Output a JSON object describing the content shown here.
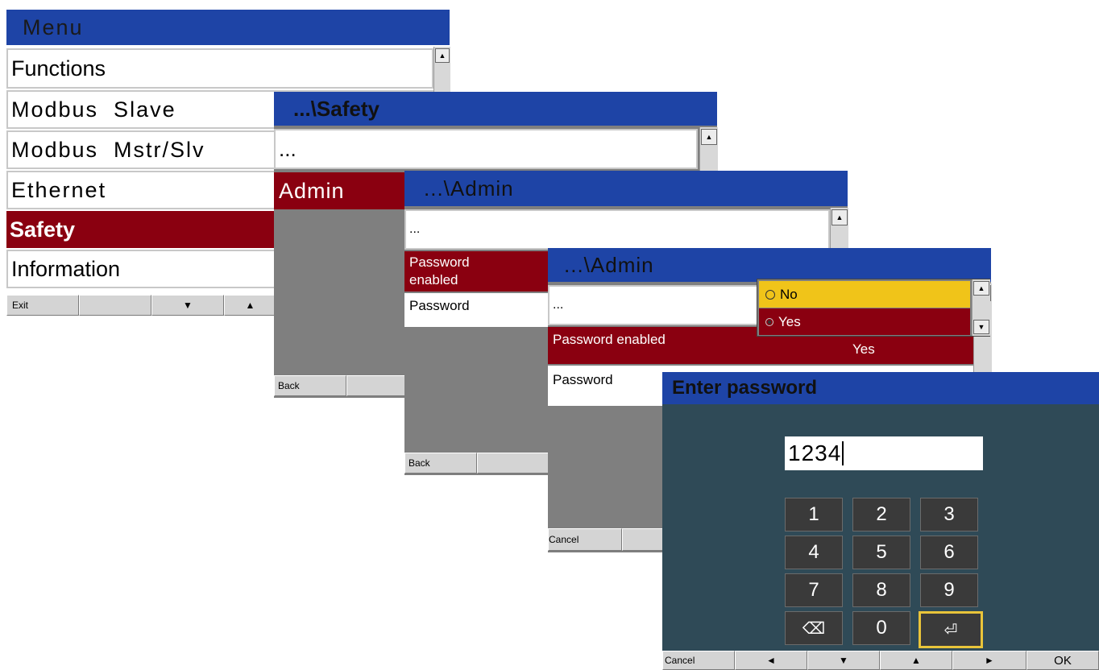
{
  "menu": {
    "title": "Menu",
    "items": [
      "Functions",
      "Modbus  Slave",
      "Modbus  Mstr/Slv",
      "Ethernet",
      "Safety",
      "Information"
    ],
    "softkeys": [
      "Exit",
      "",
      "▼",
      "▲"
    ]
  },
  "safety": {
    "title": "...\\Safety",
    "up": "...",
    "items": [
      "Admin"
    ],
    "softkeys": [
      "Back",
      ""
    ]
  },
  "admin": {
    "title": "...\\Admin",
    "up": "...",
    "items": [
      "Password enabled",
      "Password"
    ],
    "softkeys": [
      "Back",
      ""
    ]
  },
  "admin2": {
    "title": "...\\Admin",
    "up": "...",
    "row_label": "Password enabled",
    "row_value": "Yes",
    "row2_label": "Password",
    "softkeys": [
      "Cancel",
      ""
    ],
    "dropdown": {
      "options": [
        {
          "label": "No",
          "selected": false
        },
        {
          "label": "Yes",
          "selected": true
        }
      ]
    }
  },
  "password": {
    "title": "Enter password",
    "value": "1234",
    "keys": [
      "1",
      "2",
      "3",
      "4",
      "5",
      "6",
      "7",
      "8",
      "9",
      "⌫",
      "0",
      "⏎"
    ],
    "softkeys": [
      "Cancel",
      "◄",
      "▼",
      "▲",
      "►",
      "OK"
    ]
  },
  "colors": {
    "title_blue": "#1e44a6",
    "selection_red": "#8a0010",
    "highlight_yellow": "#f0c419",
    "keypad_bg": "#2f4a57"
  }
}
